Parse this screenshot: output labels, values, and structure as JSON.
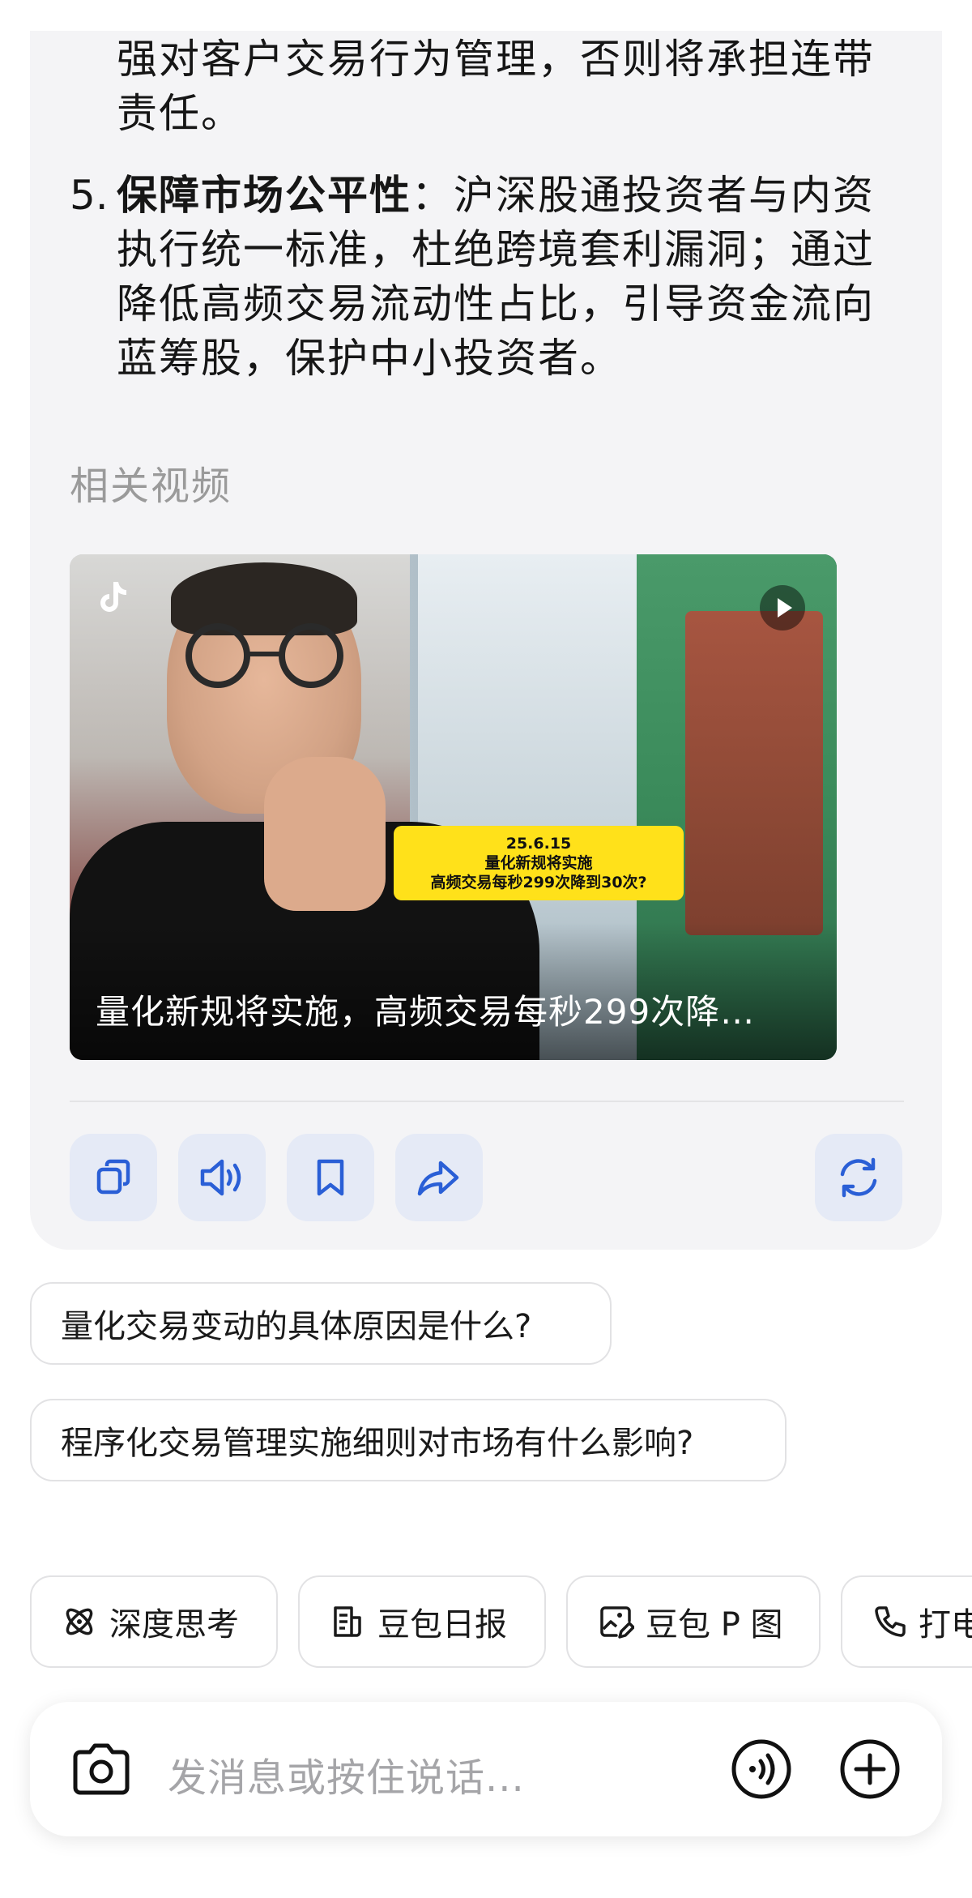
{
  "answer": {
    "prev_point_lines": [
      "强对客户交易行为管理，否则将承担连带",
      "责任。"
    ],
    "point5": {
      "number": "5.",
      "title": "保障市场公平性",
      "lines": [
        "：沪深股通投资者与内资",
        "执行统一标准，杜绝跨境套利漏洞；通过",
        "降低高频交易流动性占比，引导资金流向",
        "蓝筹股，保护中小投资者。"
      ]
    }
  },
  "related_videos": {
    "heading": "相关视频",
    "video": {
      "overlay_lines": [
        "25.6.15",
        "量化新规将实施",
        "高频交易每秒299次降到30次?"
      ],
      "caption": "量化新规将实施，高频交易每秒299次降…"
    }
  },
  "actions": {
    "icons": [
      "copy-icon",
      "speaker-icon",
      "bookmark-icon",
      "share-icon",
      "regenerate-icon"
    ]
  },
  "suggestions": [
    "量化交易变动的具体原因是什么?",
    "程序化交易管理实施细则对市场有什么影响?"
  ],
  "chips": [
    {
      "label": "深度思考",
      "icon": "atom-icon"
    },
    {
      "label": "豆包日报",
      "icon": "document-icon"
    },
    {
      "label": "豆包 P 图",
      "icon": "image-edit-icon"
    },
    {
      "label": "打电",
      "icon": "phone-icon"
    }
  ],
  "input": {
    "placeholder": "发消息或按住说话..."
  },
  "colors": {
    "bubble_bg": "#f4f4f6",
    "action_btn_bg": "#e5eaf6",
    "icon_blue": "#2a5fd6",
    "video_tag": "#ffe11a"
  }
}
